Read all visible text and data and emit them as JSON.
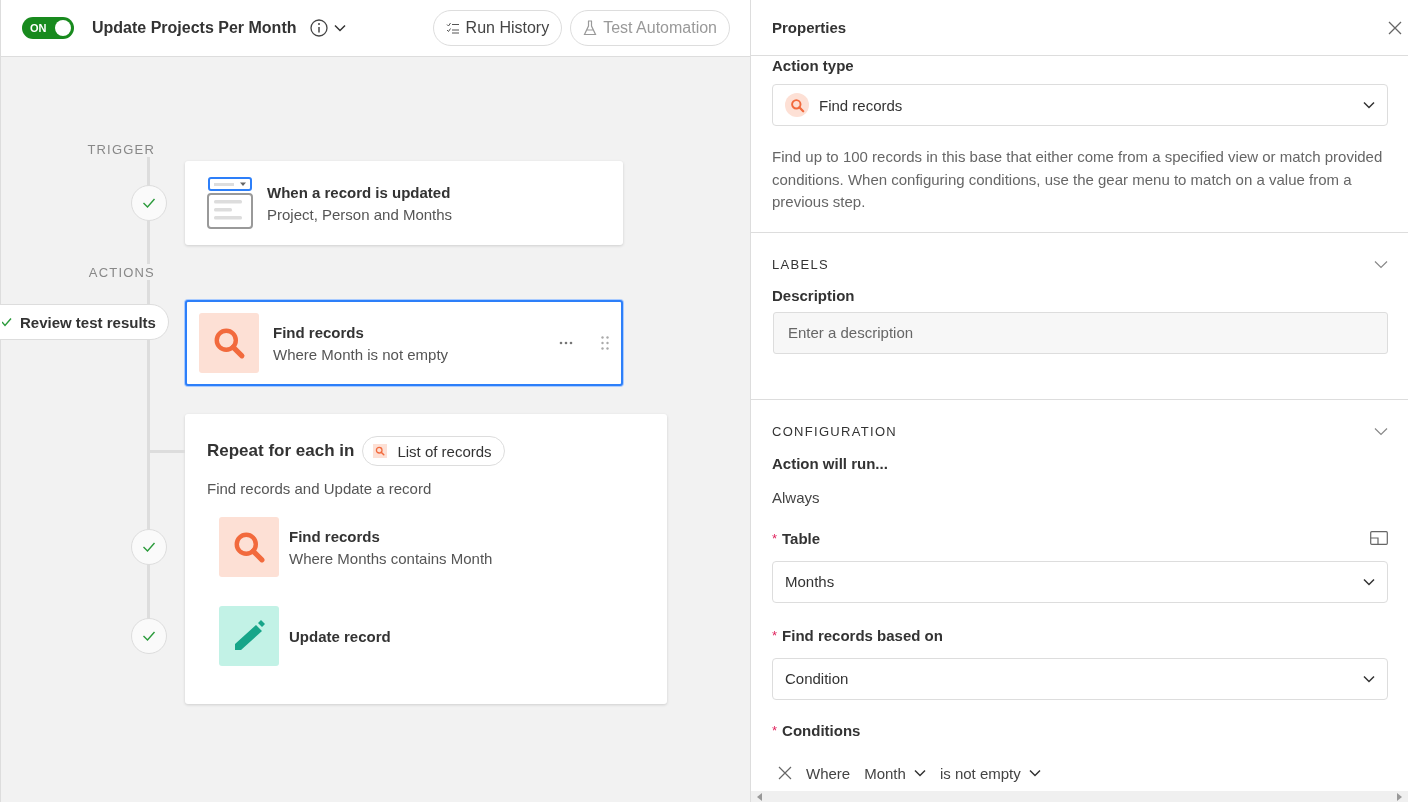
{
  "header": {
    "toggle": {
      "label": "ON",
      "on": true
    },
    "title": "Update Projects Per Month",
    "buttons": [
      {
        "kind": "history",
        "label": "Run History",
        "disabled": false
      },
      {
        "kind": "test",
        "label": "Test Automation",
        "disabled": true
      }
    ]
  },
  "canvas": {
    "trigger_label": "TRIGGER",
    "trigger": {
      "title": "When a record is updated",
      "subtitle": "Project, Person and Months",
      "done": true
    },
    "actions_label": "ACTIONS",
    "review_button": "Review test results",
    "actions": [
      {
        "kind": "find",
        "title": "Find records",
        "subtitle": "Where Month is not empty",
        "selected": true
      }
    ],
    "repeat": {
      "title": "Repeat for each in",
      "source": "List of records",
      "subtitle": "Find records and Update a record",
      "steps": [
        {
          "kind": "find",
          "title": "Find records",
          "subtitle": "Where Months contains Month",
          "done": true
        },
        {
          "kind": "update",
          "title": "Update record",
          "done": true
        }
      ]
    }
  },
  "properties": {
    "title": "Properties",
    "action_type_label": "Action type",
    "action_type": "Find records",
    "description": "Find up to 100 records in this base that either come from a specified view or match provided conditions. When configuring conditions, use the gear menu to match on a value from a previous step.",
    "labels": {
      "heading": "LABELS",
      "expanded": true,
      "field_label": "Description",
      "placeholder": "Enter a description"
    },
    "configuration": {
      "heading": "CONFIGURATION",
      "expanded": true,
      "run_label": "Action will run...",
      "run_value": "Always",
      "fields": [
        {
          "label": "Table",
          "required_mark": "*",
          "value": "Months"
        },
        {
          "label": "Find records based on",
          "required_mark": "*",
          "value": "Condition"
        }
      ],
      "conditions_label": "Conditions",
      "conditions_required_mark": "*",
      "condition": {
        "prefix": "Where",
        "field": "Month",
        "operator": "is not empty"
      }
    }
  }
}
